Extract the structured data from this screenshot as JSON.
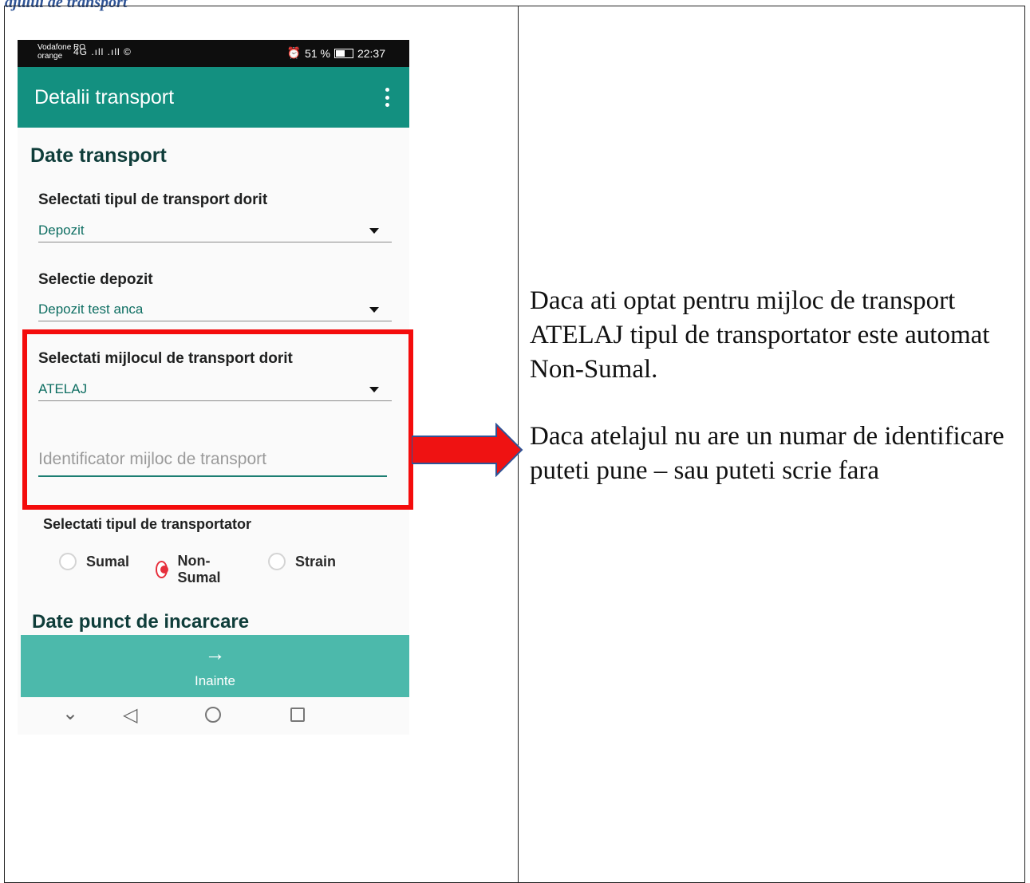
{
  "page_header": "ajului de transport",
  "status_bar": {
    "carrier_line1": "Vodafone RO",
    "carrier_line2": "orange",
    "signal": "4G .ıll .ıll ©",
    "alarm": "⏰",
    "battery_pct": "51 %",
    "time": "22:37"
  },
  "app_bar": {
    "title": "Detalii transport"
  },
  "form": {
    "section_transport": "Date transport",
    "tip_transport_label": "Selectati tipul de transport dorit",
    "tip_transport_value": "Depozit",
    "depozit_label": "Selectie depozit",
    "depozit_value": "Depozit test anca",
    "mijloc_label": "Selectati mijlocul de transport dorit",
    "mijloc_value": "ATELAJ",
    "identificator_placeholder": "Identificator mijloc de transport",
    "transportator_label": "Selectati tipul de transportator",
    "radio_options": [
      {
        "label": "Sumal",
        "selected": false
      },
      {
        "label": "Non-Sumal",
        "selected": true
      },
      {
        "label": "Strain",
        "selected": false
      }
    ],
    "section_incarcare": "Date punct de incarcare"
  },
  "next_button": {
    "icon": "arrow-right-icon",
    "label": "Inainte"
  },
  "nav_bar": {
    "icons": [
      "chevron-down-icon",
      "back-icon",
      "home-icon",
      "recents-icon"
    ]
  },
  "notes": {
    "paragraph1": "Daca ati optat pentru mijloc de transport ATELAJ  tipul de transportator este automat Non-Sumal.",
    "paragraph2": "Daca atelajul nu are un numar de identificare puteti pune – sau puteti scrie fara"
  },
  "colors": {
    "app_bar": "#139080",
    "next_button": "#4cb9ab",
    "highlight_box": "#f40c0c",
    "radio_selected": "#e62e3b",
    "arrow_fill": "#ef1212",
    "arrow_outline": "#2f5496"
  }
}
